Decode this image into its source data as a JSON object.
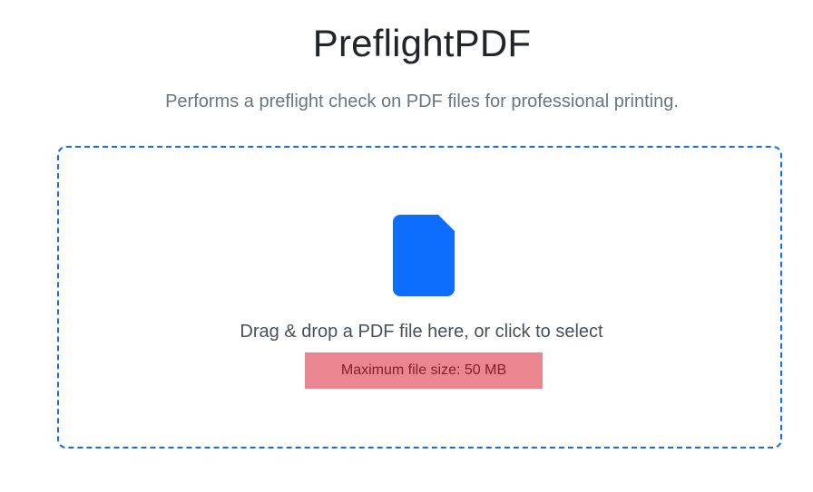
{
  "header": {
    "title": "PreflightPDF",
    "subtitle": "Performs a preflight check on PDF files for professional printing."
  },
  "dropzone": {
    "icon": "file-icon",
    "instruction": "Drag & drop a PDF file here, or click to select",
    "max_size_notice": "Maximum file size: 50 MB"
  },
  "colors": {
    "accent": "#0d6efd",
    "notice_background": "#ea868f",
    "notice_text": "#842029",
    "muted_text": "#6c757d"
  }
}
